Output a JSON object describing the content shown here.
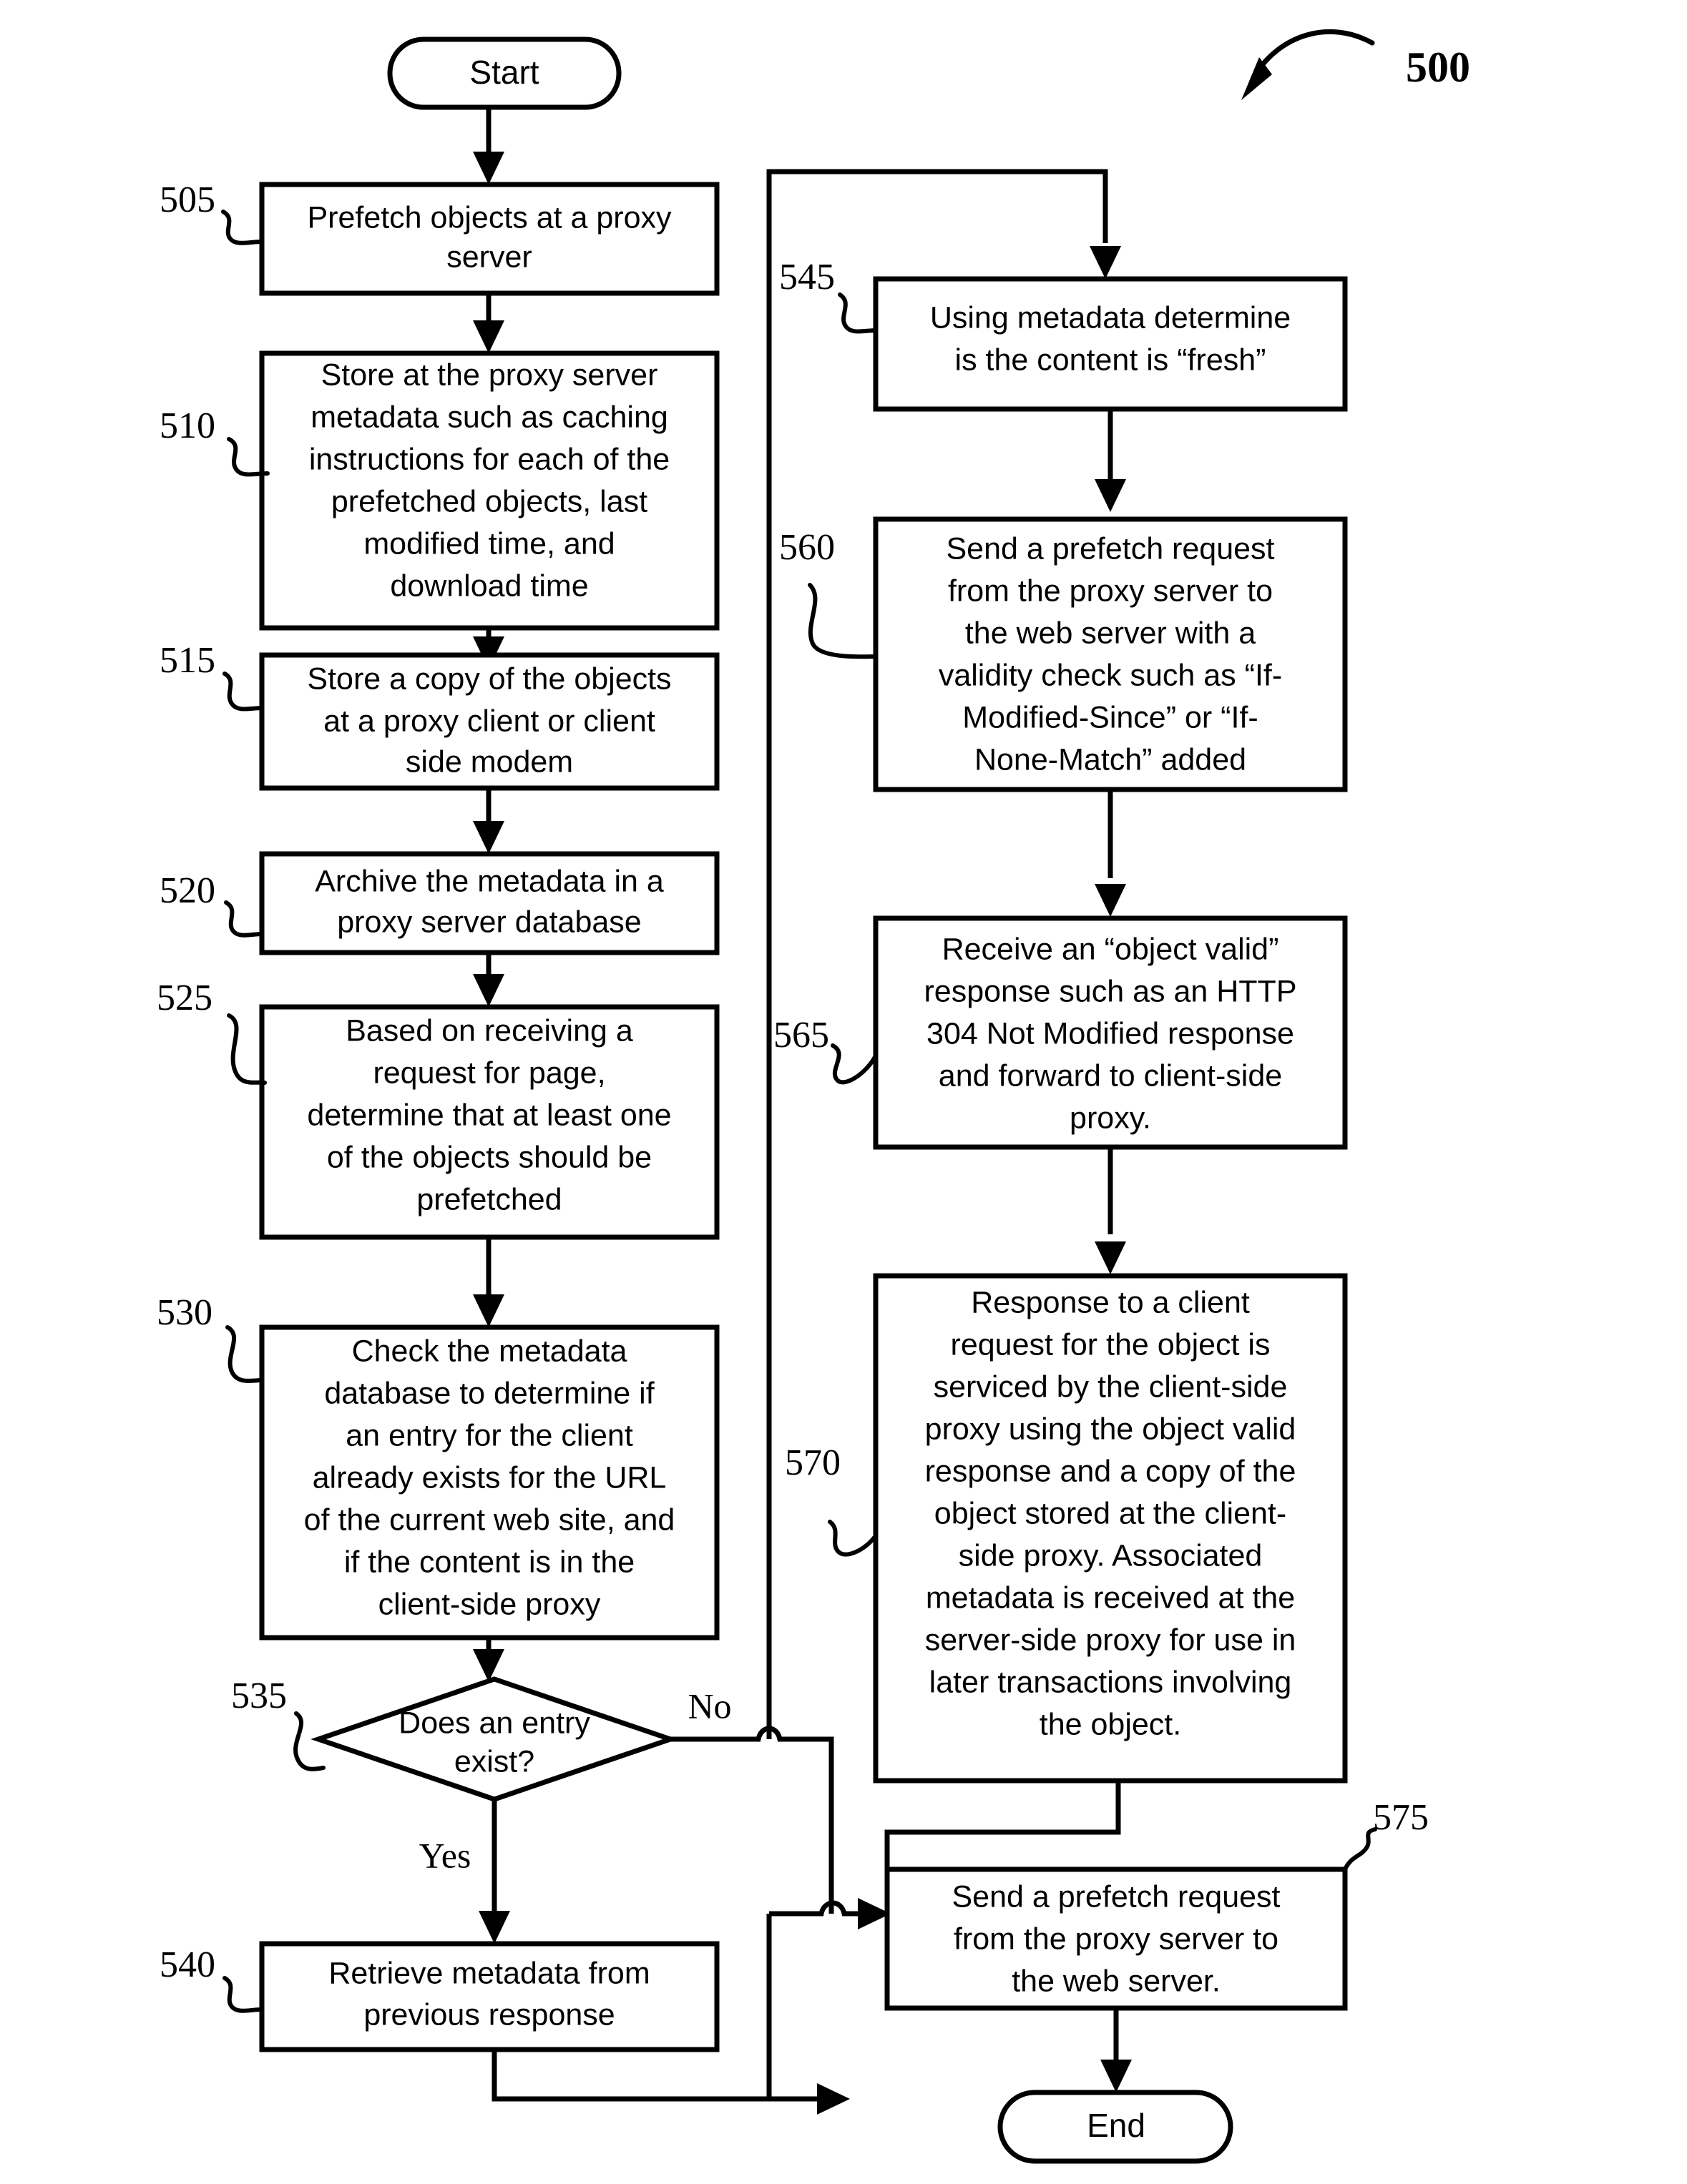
{
  "figure": {
    "number": "500",
    "type": "flowchart"
  },
  "terminators": {
    "start": "Start",
    "end": "End"
  },
  "branch_labels": {
    "yes": "Yes",
    "no": "No"
  },
  "steps": [
    {
      "ref": "505",
      "lines": [
        "Prefetch objects at a proxy",
        "server"
      ]
    },
    {
      "ref": "510",
      "lines": [
        "Store at the proxy server",
        "metadata such as caching",
        "instructions for each of the",
        "prefetched objects, last",
        "modified time, and",
        "download time"
      ]
    },
    {
      "ref": "515",
      "lines": [
        "Store a copy of the objects",
        "at a proxy client or client",
        "side modem"
      ]
    },
    {
      "ref": "520",
      "lines": [
        "Archive the metadata in a",
        "proxy server database"
      ]
    },
    {
      "ref": "525",
      "lines": [
        "Based on receiving a",
        "request for page,",
        "determine that at least one",
        "of the objects should be",
        "prefetched"
      ]
    },
    {
      "ref": "530",
      "lines": [
        "Check the metadata",
        "database to determine if",
        "an entry for the client",
        "already exists for the URL",
        "of the current web site, and",
        "if the content is in the",
        "client-side proxy"
      ]
    },
    {
      "ref": "535",
      "lines": [
        "Does an entry",
        "exist?"
      ]
    },
    {
      "ref": "540",
      "lines": [
        "Retrieve metadata from",
        "previous response"
      ]
    },
    {
      "ref": "545",
      "lines": [
        "Using metadata determine",
        "is the content is “fresh”"
      ]
    },
    {
      "ref": "560",
      "lines": [
        "Send a prefetch request",
        "from the proxy server to",
        "the web server with a",
        "validity check such as “If-",
        "Modified-Since” or “If-",
        "None-Match” added"
      ]
    },
    {
      "ref": "565",
      "lines": [
        "Receive an “object valid”",
        "response such as an HTTP",
        "304 Not Modified response",
        "and forward to client-side",
        "proxy."
      ]
    },
    {
      "ref": "570",
      "lines": [
        "Response to a client",
        "request for the object is",
        "serviced by the client-side",
        "proxy using the object valid",
        "response and a copy of the",
        "object stored at the client-",
        "side proxy.  Associated",
        "metadata is received at the",
        "server-side proxy for use in",
        "later transactions involving",
        "the object."
      ]
    },
    {
      "ref": "575",
      "lines": [
        "Send a prefetch request",
        "from the proxy server to",
        "the web server."
      ]
    }
  ],
  "colors": {
    "stroke": "#000000",
    "fill": "#ffffff"
  }
}
